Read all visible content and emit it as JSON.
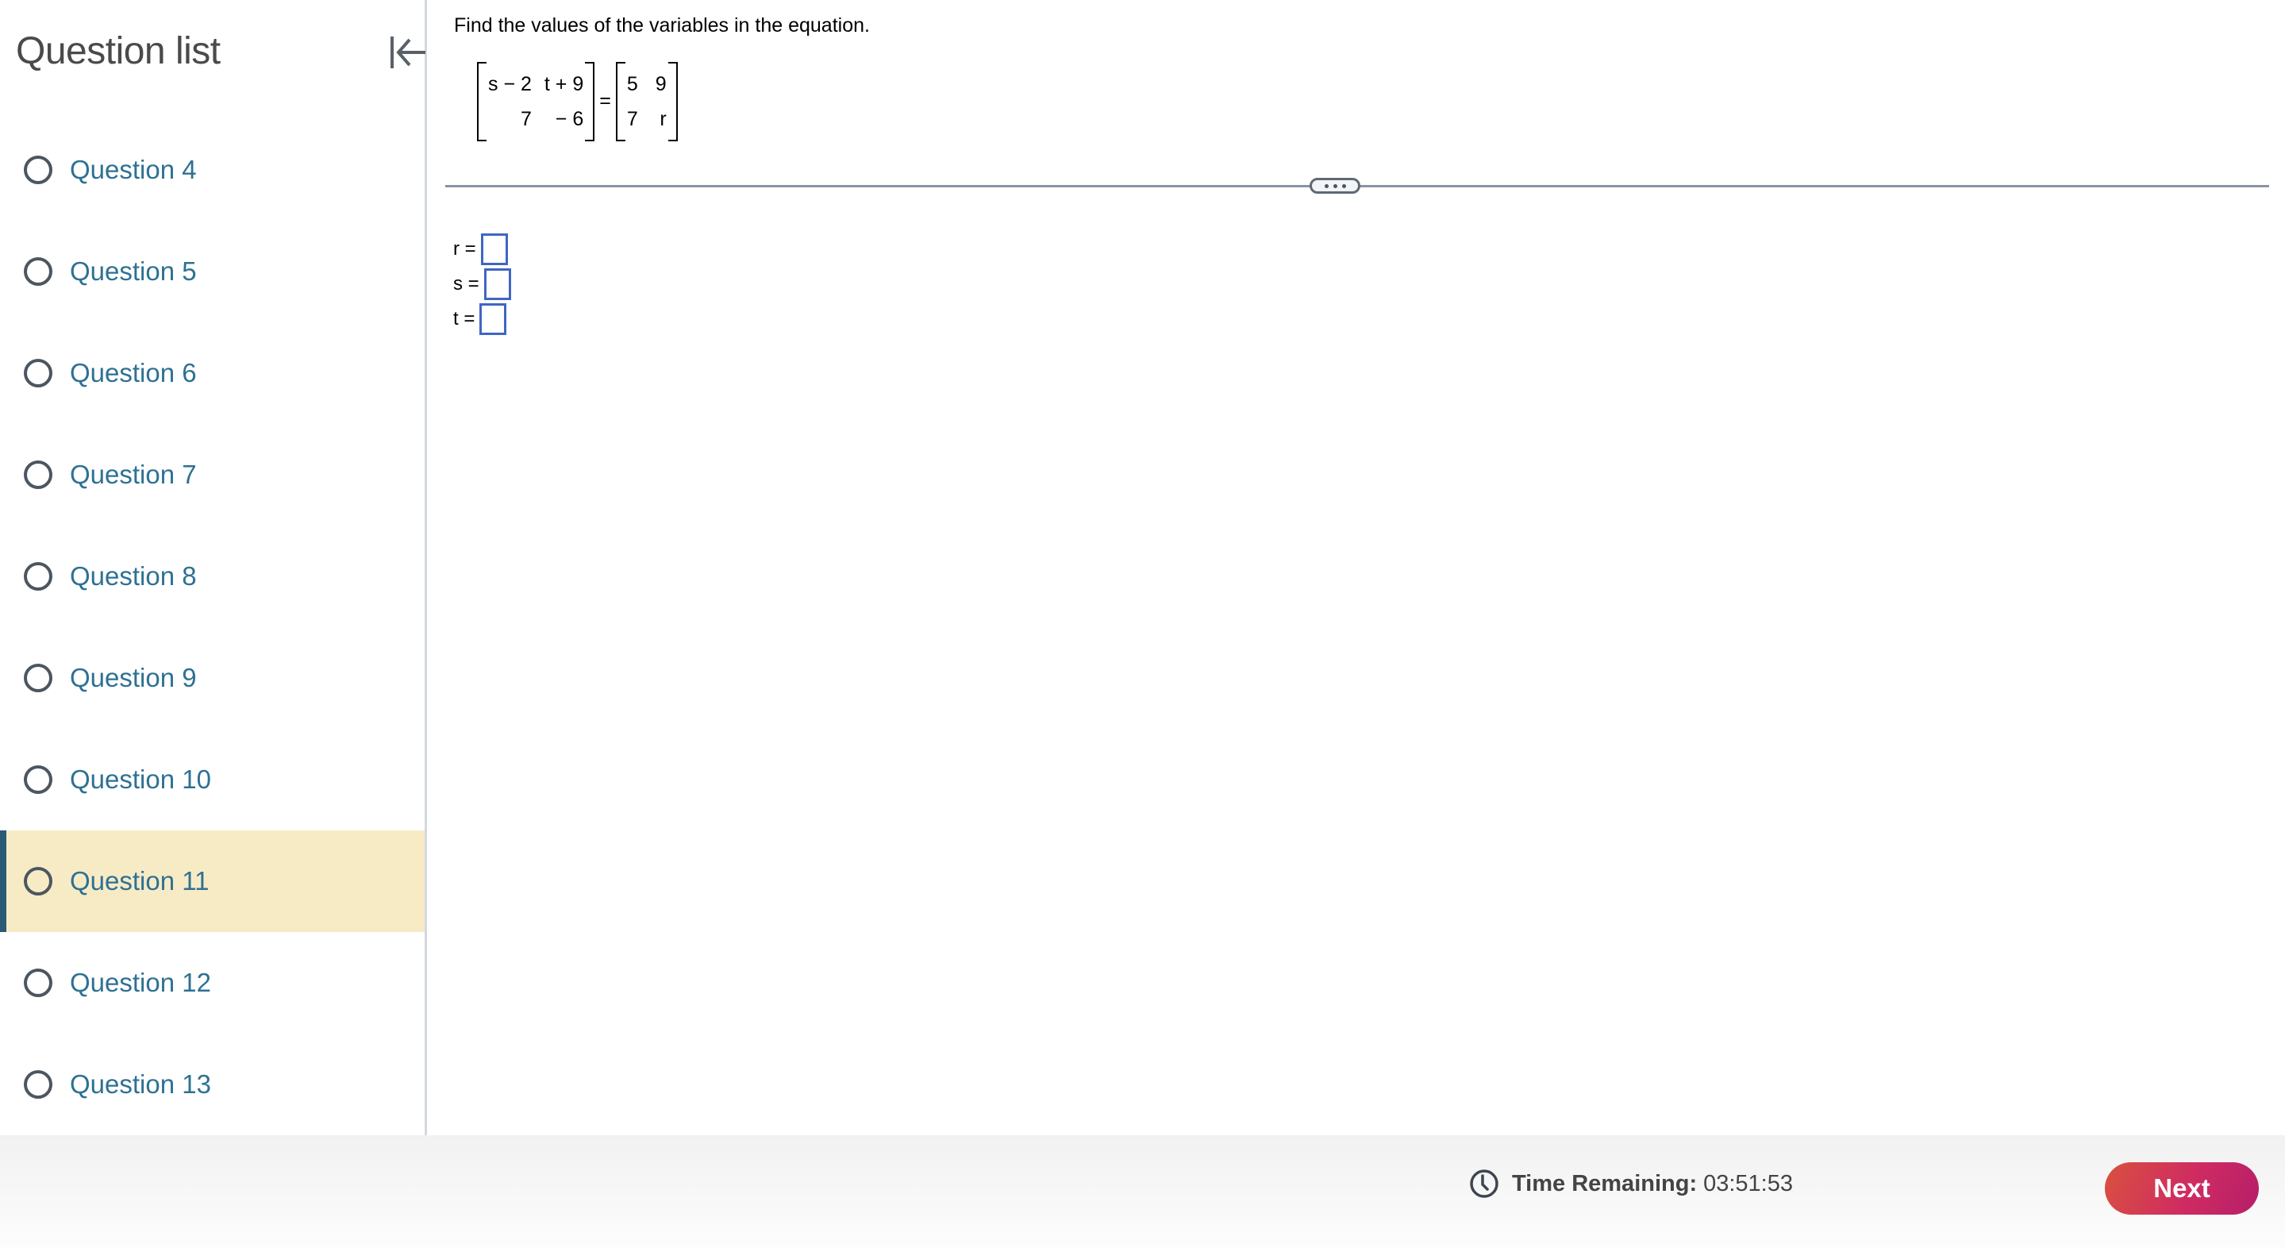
{
  "sidebar": {
    "title": "Question list",
    "collapse_icon": "collapse-left-icon",
    "items": [
      {
        "label": "Question 4",
        "active": false
      },
      {
        "label": "Question 5",
        "active": false
      },
      {
        "label": "Question 6",
        "active": false
      },
      {
        "label": "Question 7",
        "active": false
      },
      {
        "label": "Question 8",
        "active": false
      },
      {
        "label": "Question 9",
        "active": false
      },
      {
        "label": "Question 10",
        "active": false
      },
      {
        "label": "Question 11",
        "active": true
      },
      {
        "label": "Question 12",
        "active": false
      },
      {
        "label": "Question 13",
        "active": false
      }
    ]
  },
  "question": {
    "prompt": "Find the values of the variables in the equation.",
    "left_matrix": [
      [
        "s − 2",
        "t + 9"
      ],
      [
        "7",
        "− 6"
      ]
    ],
    "equals": "=",
    "right_matrix": [
      [
        "5",
        "9"
      ],
      [
        "7",
        "r"
      ]
    ],
    "more_button": "more-options-icon"
  },
  "answers": [
    {
      "label": "r =",
      "value": ""
    },
    {
      "label": "s =",
      "value": ""
    },
    {
      "label": "t =",
      "value": ""
    }
  ],
  "footer": {
    "timer_label": "Time Remaining:",
    "timer_value": "03:51:53",
    "next_label": "Next"
  },
  "colors": {
    "link": "#2e7193",
    "active_bg": "#f7ebc6",
    "active_bar": "#2a5a75",
    "answer_box": "#3f66c4",
    "next_gradient_start": "#d9513f",
    "next_gradient_end": "#b61e68"
  }
}
